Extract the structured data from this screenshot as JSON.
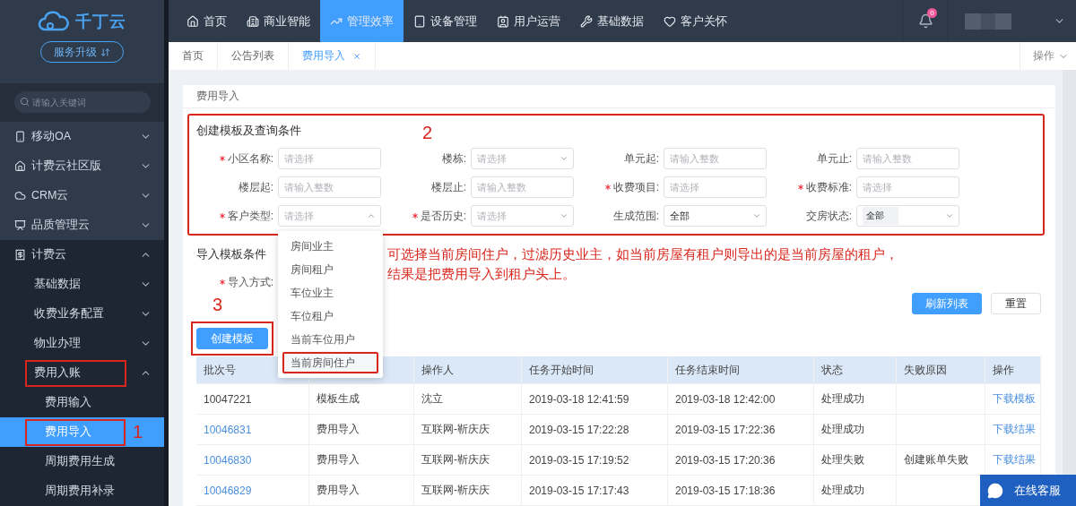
{
  "brand": {
    "name": "千丁云",
    "upgrade_button": "服务升级"
  },
  "sidebar": {
    "search": {
      "placeholder": "请输入关键词"
    },
    "items": [
      {
        "label": "移动OA",
        "expanded": false
      },
      {
        "label": "计费云社区版",
        "expanded": false
      },
      {
        "label": "CRM云",
        "expanded": false
      },
      {
        "label": "品质管理云",
        "expanded": false
      },
      {
        "label": "计费云",
        "expanded": true,
        "children": [
          {
            "label": "基础数据",
            "expanded": false,
            "highlighted": false
          },
          {
            "label": "收费业务配置",
            "expanded": false,
            "highlighted": false
          },
          {
            "label": "物业办理",
            "expanded": false,
            "highlighted": false
          },
          {
            "label": "费用入账",
            "expanded": true,
            "highlighted": true,
            "children": [
              {
                "label": "费用输入",
                "selected": false,
                "highlighted": false
              },
              {
                "label": "费用导入",
                "selected": true,
                "highlighted": true,
                "callout": "1"
              },
              {
                "label": "周期费用生成",
                "selected": false,
                "highlighted": false
              },
              {
                "label": "周期费用补录",
                "selected": false,
                "highlighted": false
              }
            ]
          }
        ]
      }
    ]
  },
  "top_nav": {
    "items": [
      {
        "label": "首页",
        "selected": false
      },
      {
        "label": "商业智能",
        "selected": false
      },
      {
        "label": "管理效率",
        "selected": true
      },
      {
        "label": "设备管理",
        "selected": false
      },
      {
        "label": "用户运营",
        "selected": false
      },
      {
        "label": "基础数据",
        "selected": false
      },
      {
        "label": "客户关怀",
        "selected": false
      }
    ],
    "notification_badge": "0"
  },
  "tabs": {
    "items": [
      {
        "label": "首页",
        "selected": false,
        "closable": false
      },
      {
        "label": "公告列表",
        "selected": false,
        "closable": false
      },
      {
        "label": "费用导入",
        "selected": true,
        "closable": true
      }
    ],
    "actions": "操作"
  },
  "card": {
    "title": "费用导入",
    "query": {
      "title": "创建模板及查询条件",
      "callout": "2",
      "fields": [
        {
          "label": "小区名称:",
          "required": true,
          "kind": "input",
          "placeholder": "请选择"
        },
        {
          "label": "楼栋:",
          "required": false,
          "kind": "select",
          "placeholder": "请选择"
        },
        {
          "label": "单元起:",
          "required": false,
          "kind": "input",
          "placeholder": "请输入整数"
        },
        {
          "label": "单元止:",
          "required": false,
          "kind": "input",
          "placeholder": "请输入整数"
        },
        {
          "label": "楼层起:",
          "required": false,
          "kind": "input",
          "placeholder": "请输入整数"
        },
        {
          "label": "楼层止:",
          "required": false,
          "kind": "input",
          "placeholder": "请输入整数"
        },
        {
          "label": "收费项目:",
          "required": true,
          "kind": "input",
          "placeholder": "请选择"
        },
        {
          "label": "收费标准:",
          "required": true,
          "kind": "input",
          "placeholder": "请选择"
        },
        {
          "label": "客户类型:",
          "required": true,
          "kind": "select",
          "placeholder": "请选择",
          "open": true,
          "options": [
            {
              "label": "房间业主",
              "highlighted": false
            },
            {
              "label": "房间租户",
              "highlighted": false
            },
            {
              "label": "车位业主",
              "highlighted": false
            },
            {
              "label": "车位租户",
              "highlighted": false
            },
            {
              "label": "当前车位用户",
              "highlighted": false
            },
            {
              "label": "当前房间住户",
              "highlighted": true
            }
          ]
        },
        {
          "label": "是否历史:",
          "required": true,
          "kind": "select",
          "placeholder": "请选择"
        },
        {
          "label": "生成范围:",
          "required": false,
          "kind": "select",
          "value": "全部"
        },
        {
          "label": "交房状态:",
          "required": false,
          "kind": "tags",
          "tags": [
            "全部"
          ]
        }
      ]
    },
    "import": {
      "title": "导入模板条件",
      "fields": [
        {
          "label": "导入方式:",
          "required": true
        }
      ],
      "note_lines": [
        "可选择当前房间住户，过滤历史业主，如当前房屋有租户则导出的是当前房屋的租户，",
        "结果是把费用导入到租户头上。"
      ]
    },
    "refresh_button": "刷新列表",
    "reset_button": "重置",
    "create_button": {
      "label": "创建模板",
      "callout": "3"
    },
    "table": {
      "columns": [
        "批次号",
        null,
        "操作人",
        "任务开始时间",
        "任务结束时间",
        "状态",
        "失败原因",
        "操作"
      ],
      "rows": [
        {
          "batch_id": "10047221",
          "linked": false,
          "type": "模板生成",
          "operator": "沈立",
          "start": "2019-03-18 12:41:59",
          "end": "2019-03-18 12:42:00",
          "status": "处理成功",
          "action": "下载模板"
        },
        {
          "batch_id": "10046831",
          "linked": true,
          "type": "费用导入",
          "operator": "互联网-靳庆庆",
          "start": "2019-03-15 17:22:28",
          "end": "2019-03-15 17:22:36",
          "status": "处理成功",
          "action": "下载结果"
        },
        {
          "batch_id": "10046830",
          "linked": true,
          "type": "费用导入",
          "operator": "互联网-靳庆庆",
          "start": "2019-03-15 17:19:52",
          "end": "2019-03-15 17:20:36",
          "status": "处理失败",
          "failure_reason": "创建账单失败",
          "action": "下载结果"
        },
        {
          "batch_id": "10046829",
          "linked": true,
          "type": "费用导入",
          "operator": "互联网-靳庆庆",
          "start": "2019-03-15 17:17:43",
          "end": "2019-03-15 17:18:36",
          "status": "处理成功"
        }
      ]
    }
  },
  "chat_button": "在线客服"
}
